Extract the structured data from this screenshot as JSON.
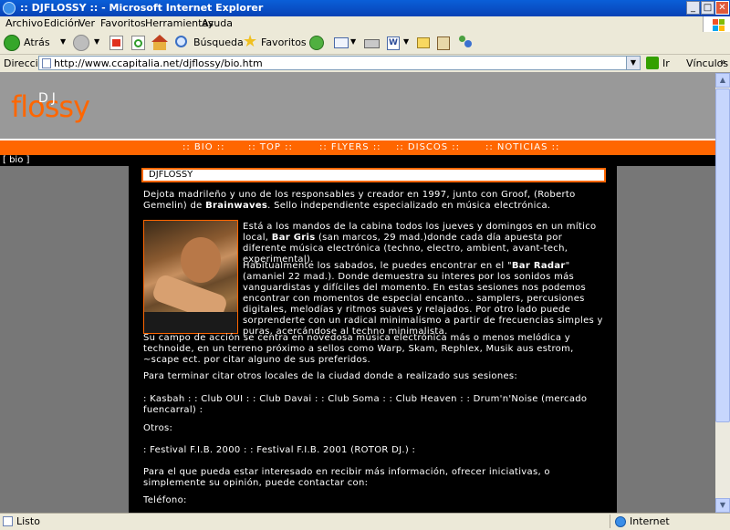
{
  "window": {
    "title": ":: DJFLOSSY :: - Microsoft Internet Explorer",
    "minimize": "_",
    "maximize": "□",
    "close": "✕"
  },
  "menu": [
    "Archivo",
    "Edición",
    "Ver",
    "Favoritos",
    "Herramientas",
    "Ayuda"
  ],
  "toolbar": {
    "back": "Atrás",
    "search": "Búsqueda",
    "favorites": "Favoritos"
  },
  "address": {
    "label": "Dirección",
    "url": "http://www.ccapitalia.net/djflossy/bio.htm",
    "go": "Ir",
    "links": "Vínculos"
  },
  "status": {
    "text": "Listo",
    "zone": "Internet"
  },
  "site": {
    "logo_dj": "DJ",
    "logo_name": "flossy",
    "nav": [
      ":: BIO ::",
      ":: TOP ::",
      ":: FLYERS ::",
      ":: DISCOS ::",
      ":: NOTICIAS ::"
    ],
    "breadcrumb": "[ bio ]",
    "title": "DJFLOSSY",
    "p1_a": "Dejota madrileño y uno de los responsables y creador en 1997, junto con Groof, (Roberto Gemelin) de ",
    "p1_b": "Brainwaves",
    "p1_c": ". Sello independiente especializado en música electrónica.",
    "p2_a": "Está a los mandos de la cabina todos los jueves y domingos en un mítico local, ",
    "p2_b": "Bar Gris",
    "p2_c": " (san marcos, 29 mad.)donde cada día apuesta por diferente música electrónica (techno, electro, ambient, avant-tech, experimental).",
    "p3_a": "Habitualmente los sabados, le puedes encontrar en el \"",
    "p3_b": "Bar Radar",
    "p3_c": "\" (amaniel 22 mad.). Donde demuestra su interes por los sonidos más vanguardistas y difíciles del momento. En estas sesiones nos podemos encontrar con momentos de especial encanto... samplers, percusiones digitales, melodías y ritmos suaves y relajados. Por otro lado puede sorprenderte con un radical minimalismo a partir de frecuencias simples y puras, acercándose al techno minimalista.",
    "p4": "Su campo de acción se centra en novedosa música electrónica más o menos melódica y technoide, en un terreno próximo a sellos como Warp, Skam, Rephlex, Musik aus estrom, ~scape ect. por citar alguno de sus preferidos.",
    "p5": "Para terminar citar otros locales de la ciudad donde a realizado sus sesiones:",
    "p6": ": Kasbah : : Club OUI : : Club Davai : : Club Soma : : Club Heaven : : Drum'n'Noise (mercado fuencarral) :",
    "p7": "Otros:",
    "p8": ": Festival F.I.B. 2000 : : Festival F.I.B. 2001 (ROTOR DJ.) :",
    "p9": "Para el que pueda estar interesado en recibir más información, ofrecer iniciativas, o simplemente su opinión, puede contactar con:",
    "p10": "Teléfono:"
  }
}
